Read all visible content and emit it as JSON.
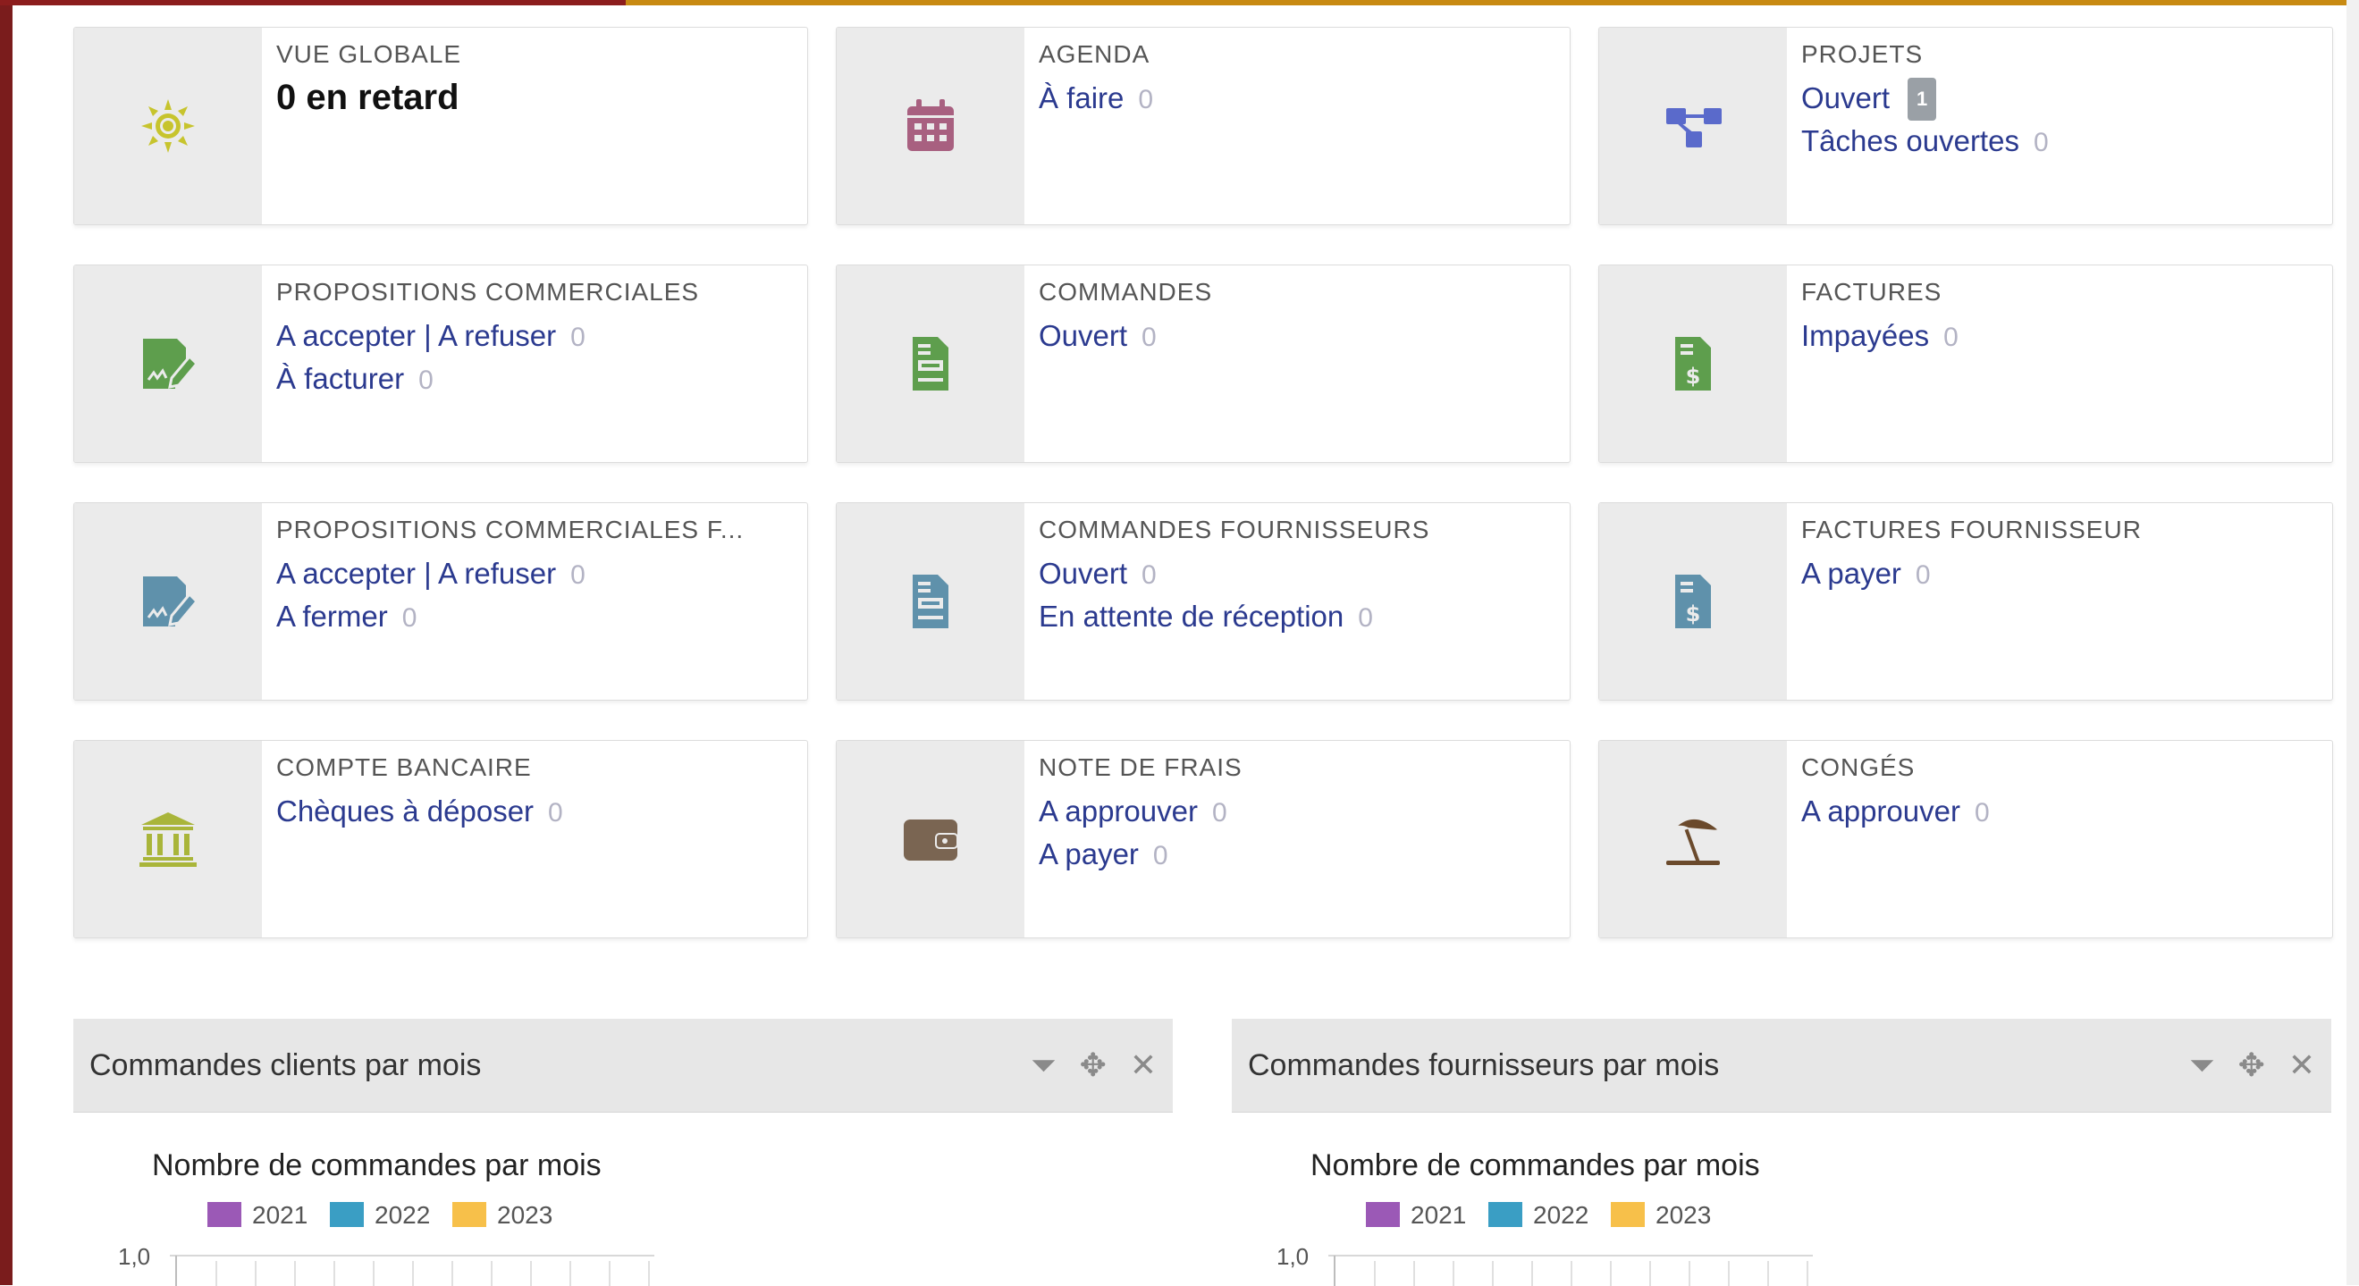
{
  "boxes": {
    "vue_globale": {
      "title": "VUE GLOBALE",
      "value": "0 en retard",
      "icon": "sun-icon",
      "color": "#c7c42d"
    },
    "agenda": {
      "title": "AGENDA",
      "lines": [
        {
          "label": "À faire",
          "count": "0"
        }
      ],
      "icon": "calendar-icon",
      "color": "#a86080"
    },
    "projets": {
      "title": "PROJETS",
      "lines": [
        {
          "label": "Ouvert",
          "badge": "1"
        },
        {
          "label": "Tâches ouvertes",
          "count": "0"
        }
      ],
      "icon": "project-icon",
      "color": "#5a6acb"
    },
    "propositions": {
      "title": "PROPOSITIONS COMMERCIALES",
      "lines": [
        {
          "label": "A accepter | A refuser",
          "count": "0"
        },
        {
          "label": "À facturer",
          "count": "0"
        }
      ],
      "icon": "signature-icon",
      "color": "#5e9e4d"
    },
    "commandes": {
      "title": "COMMANDES",
      "lines": [
        {
          "label": "Ouvert",
          "count": "0"
        }
      ],
      "icon": "order-icon",
      "color": "#5e9e4d"
    },
    "factures": {
      "title": "FACTURES",
      "lines": [
        {
          "label": "Impayées",
          "count": "0"
        }
      ],
      "icon": "invoice-icon",
      "color": "#5e9e4d"
    },
    "propositions_f": {
      "title": "PROPOSITIONS COMMERCIALES F...",
      "lines": [
        {
          "label": "A accepter | A refuser",
          "count": "0"
        },
        {
          "label": "A fermer",
          "count": "0"
        }
      ],
      "icon": "signature-icon",
      "color": "#5f91ab"
    },
    "commandes_f": {
      "title": "COMMANDES FOURNISSEURS",
      "lines": [
        {
          "label": "Ouvert",
          "count": "0"
        },
        {
          "label": "En attente de réception",
          "count": "0"
        }
      ],
      "icon": "order-icon",
      "color": "#5f91ab"
    },
    "factures_f": {
      "title": "FACTURES FOURNISSEUR",
      "lines": [
        {
          "label": "A payer",
          "count": "0"
        }
      ],
      "icon": "invoice-icon",
      "color": "#5f91ab"
    },
    "compte": {
      "title": "COMPTE BANCAIRE",
      "lines": [
        {
          "label": "Chèques à déposer",
          "count": "0"
        }
      ],
      "icon": "bank-icon",
      "color": "#a9b53a"
    },
    "note_frais": {
      "title": "NOTE DE FRAIS",
      "lines": [
        {
          "label": "A approuver",
          "count": "0"
        },
        {
          "label": "A payer",
          "count": "0"
        }
      ],
      "icon": "wallet-icon",
      "color": "#7a6552"
    },
    "conges": {
      "title": "CONGÉS",
      "lines": [
        {
          "label": "A approuver",
          "count": "0"
        }
      ],
      "icon": "beach-umbrella-icon",
      "color": "#6b4a2c"
    }
  },
  "panels": {
    "clients": {
      "title": "Commandes clients par mois"
    },
    "fournisseurs": {
      "title": "Commandes fournisseurs par mois"
    },
    "tools": {
      "filter": "filter-icon",
      "move": "move-icon",
      "close": "close-icon"
    }
  },
  "chart_data": [
    {
      "type": "bar",
      "title": "Nombre de commandes par mois",
      "series": [
        {
          "name": "2021",
          "color": "#9b59b6",
          "values": []
        },
        {
          "name": "2022",
          "color": "#3a9ec4",
          "values": []
        },
        {
          "name": "2023",
          "color": "#f7c04a",
          "values": []
        }
      ],
      "yticks": [
        "1,0"
      ],
      "legend": "top"
    },
    {
      "type": "bar",
      "title": "Nombre de commandes par mois",
      "series": [
        {
          "name": "2021",
          "color": "#9b59b6",
          "values": []
        },
        {
          "name": "2022",
          "color": "#3a9ec4",
          "values": []
        },
        {
          "name": "2023",
          "color": "#f7c04a",
          "values": []
        }
      ],
      "yticks": [
        "1,0"
      ],
      "legend": "top"
    }
  ]
}
